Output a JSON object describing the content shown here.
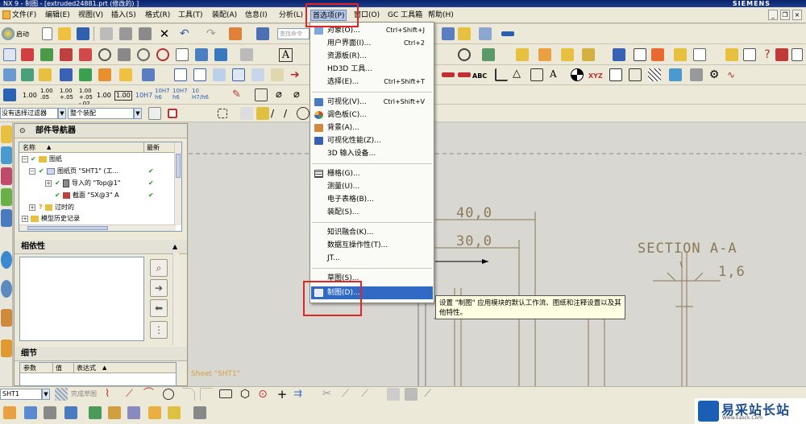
{
  "window": {
    "title": "NX 9 - 制图 - [extruded24881.prt (修改的) ]",
    "brand": "SIEMENS"
  },
  "menubar": [
    {
      "label": "文件(F)",
      "active": false
    },
    {
      "label": "编辑(E)",
      "active": false
    },
    {
      "label": "视图(V)",
      "active": false
    },
    {
      "label": "插入(S)",
      "active": false
    },
    {
      "label": "格式(R)",
      "active": false
    },
    {
      "label": "工具(T)",
      "active": false
    },
    {
      "label": "装配(A)",
      "active": false
    },
    {
      "label": "信息(I)",
      "active": false
    },
    {
      "label": "分析(L)",
      "active": false
    },
    {
      "label": "首选项(P)",
      "active": true
    },
    {
      "label": "窗口(O)",
      "active": false
    },
    {
      "label": "GC 工具箱",
      "active": false
    },
    {
      "label": "帮助(H)",
      "active": false
    }
  ],
  "toolbar": {
    "start_label": "启动",
    "search_placeholder": "查找命令",
    "filter_select": "没有选择过滤器",
    "scope_select": "整个装配",
    "precision_labels": [
      "1.00",
      "1.00 .05",
      "1.00 +.05",
      "1.00 +.05 -.02",
      "1.00",
      "1.00",
      "10H7",
      "10H7 h6",
      "10H7 h6",
      "10 H7/h6"
    ],
    "abc_label": "ABC",
    "xyz_label": "XYZ"
  },
  "part_navigator": {
    "title": "部件导航器",
    "columns": [
      "名称",
      "最新"
    ],
    "rows": [
      {
        "label": "图纸",
        "indent": 0,
        "latest": false
      },
      {
        "label": "图纸页 \"SHT1\" (工...",
        "indent": 1,
        "latest": true
      },
      {
        "label": "导入的 \"Top@1\"",
        "indent": 2,
        "latest": true
      },
      {
        "label": "截面 \"SX@3\" A",
        "indent": 2,
        "latest": true
      },
      {
        "label": "过时的",
        "indent": 0,
        "latest": false
      },
      {
        "label": "模型历史记录",
        "indent": 0,
        "latest": false
      }
    ]
  },
  "dependencies": {
    "title": "相依性"
  },
  "details": {
    "title": "细节",
    "columns": [
      "参数",
      "值",
      "表达式"
    ]
  },
  "preferences_menu": {
    "items": [
      {
        "label": "对象(O)...",
        "shortcut": "Ctrl+Shift+J",
        "icon": "object-icon"
      },
      {
        "label": "用户界面(I)...",
        "shortcut": "Ctrl+2",
        "icon": ""
      },
      {
        "label": "资源板(R)...",
        "shortcut": "",
        "icon": ""
      },
      {
        "label": "HD3D 工具...",
        "shortcut": "",
        "icon": ""
      },
      {
        "label": "选择(E)...",
        "shortcut": "Ctrl+Shift+T",
        "icon": ""
      },
      {
        "label": "可视化(V)...",
        "shortcut": "Ctrl+Shift+V",
        "icon": "visualization-icon"
      },
      {
        "label": "调色板(C)...",
        "shortcut": "",
        "icon": "palette-icon"
      },
      {
        "label": "背景(A)...",
        "shortcut": "",
        "icon": "background-icon"
      },
      {
        "label": "可视化性能(Z)...",
        "shortcut": "",
        "icon": "performance-icon"
      },
      {
        "label": "3D 输入设备...",
        "shortcut": "",
        "icon": ""
      },
      {
        "label": "栅格(G)...",
        "shortcut": "",
        "icon": "grid-icon"
      },
      {
        "label": "测量(U)...",
        "shortcut": "",
        "icon": ""
      },
      {
        "label": "电子表格(B)...",
        "shortcut": "",
        "icon": ""
      },
      {
        "label": "装配(S)...",
        "shortcut": "",
        "icon": ""
      },
      {
        "label": "知识融合(K)...",
        "shortcut": "",
        "icon": ""
      },
      {
        "label": "数据互操作性(T)...",
        "shortcut": "",
        "icon": ""
      },
      {
        "label": "JT...",
        "shortcut": "",
        "icon": ""
      },
      {
        "label": "草图(S)...",
        "shortcut": "",
        "icon": ""
      },
      {
        "label": "制图(D)...",
        "shortcut": "",
        "icon": "drafting-icon",
        "highlighted": true
      }
    ]
  },
  "tooltip": {
    "text": "设置 \"制图\" 应用模块的默认工作流、图纸和注释设置以及其他特性。"
  },
  "drawing": {
    "dim1": "40,0",
    "dim2": "30,0",
    "section_title": "SECTION A-A",
    "dim3": "1,6",
    "sheet_label": "Sheet \"SHT1\""
  },
  "bottom": {
    "sheet_select": "SHT1",
    "finish_sketch": "完成草图"
  },
  "watermark": {
    "title": "易采站长站",
    "url": "Www.Easck.Com"
  },
  "colors": {
    "menu_highlight": "#316ac5",
    "annotation_red": "#e32424",
    "drawing_ink": "#8a7a55"
  }
}
